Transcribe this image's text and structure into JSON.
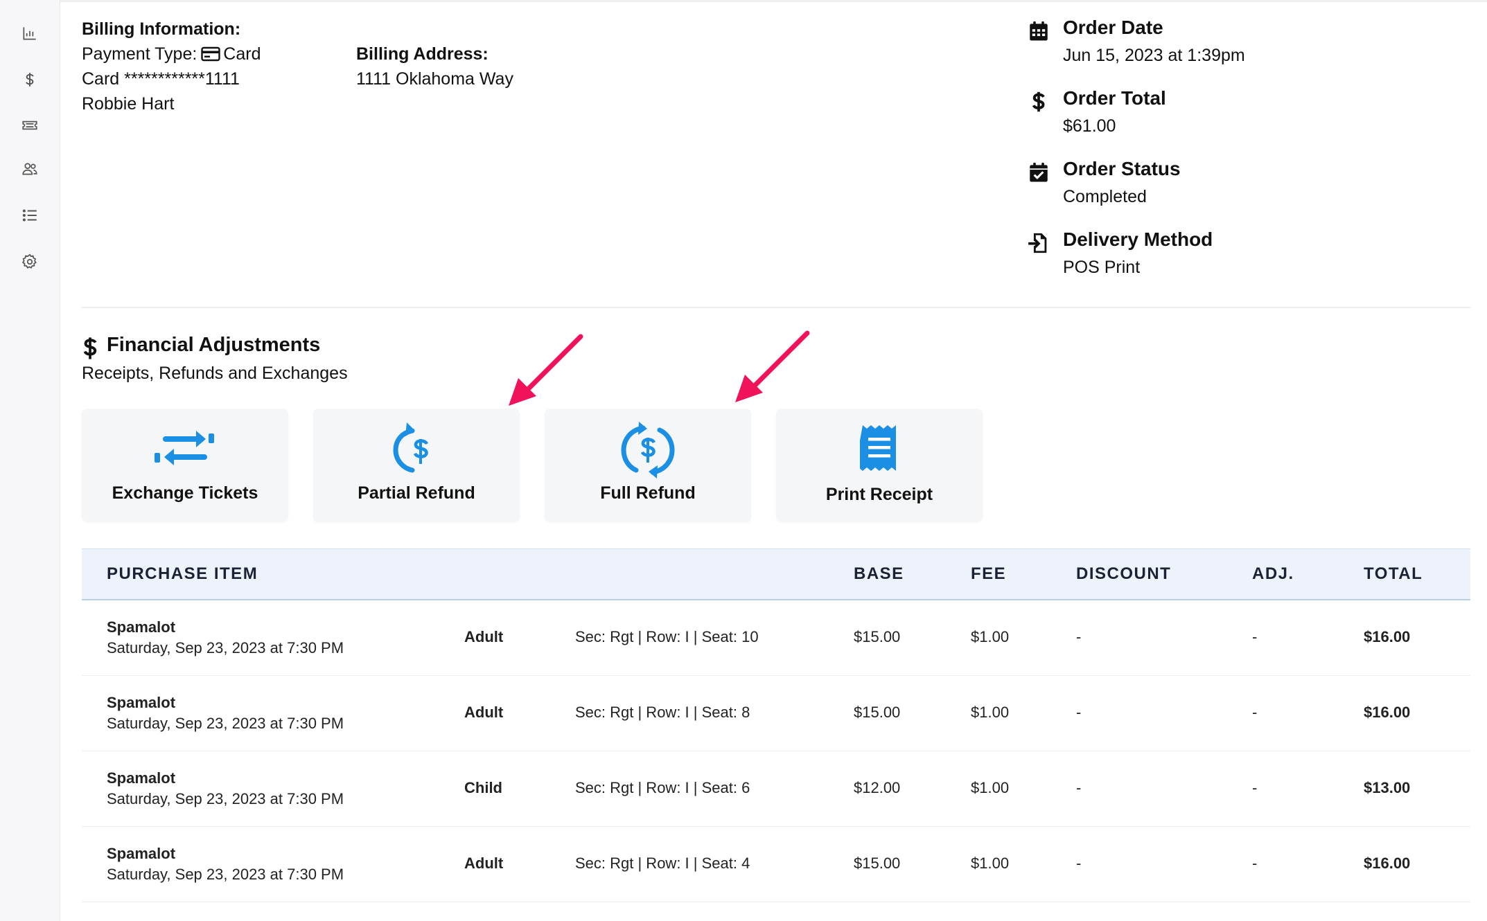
{
  "sidebar": {
    "items": [
      {
        "name": "chart-icon"
      },
      {
        "name": "dollar-icon"
      },
      {
        "name": "ticket-icon"
      },
      {
        "name": "users-icon"
      },
      {
        "name": "list-icon"
      },
      {
        "name": "gear-icon"
      }
    ]
  },
  "billing": {
    "heading": "Billing Information:",
    "payment_type_label": "Payment Type:",
    "payment_type_value": "Card",
    "card": "Card ************1111",
    "name": "Robbie Hart",
    "address_heading": "Billing Address:",
    "address": "1111 Oklahoma Way"
  },
  "order": {
    "date_label": "Order Date",
    "date_value": "Jun 15, 2023 at 1:39pm",
    "total_label": "Order Total",
    "total_value": "$61.00",
    "status_label": "Order Status",
    "status_value": "Completed",
    "delivery_label": "Delivery Method",
    "delivery_value": "POS Print"
  },
  "financial": {
    "title": "Financial Adjustments",
    "subtitle": "Receipts, Refunds and Exchanges",
    "actions": [
      {
        "label": "Exchange Tickets",
        "icon": "exchange-icon"
      },
      {
        "label": "Partial Refund",
        "icon": "partial-refund-icon"
      },
      {
        "label": "Full Refund",
        "icon": "full-refund-icon"
      },
      {
        "label": "Print Receipt",
        "icon": "receipt-icon"
      }
    ]
  },
  "colors": {
    "accent": "#1a8fe3",
    "annotation_arrow": "#f0135a",
    "header_bg": "#eef3fb"
  },
  "table": {
    "headers": {
      "item": "PURCHASE ITEM",
      "base": "BASE",
      "fee": "FEE",
      "discount": "DISCOUNT",
      "adj": "ADJ.",
      "total": "TOTAL"
    },
    "rows": [
      {
        "event": "Spamalot",
        "date": "Saturday, Sep 23, 2023 at 7:30 PM",
        "type": "Adult",
        "seat": "Sec: Rgt | Row: I | Seat: 10",
        "base": "$15.00",
        "fee": "$1.00",
        "discount": "-",
        "adj": "-",
        "total": "$16.00"
      },
      {
        "event": "Spamalot",
        "date": "Saturday, Sep 23, 2023 at 7:30 PM",
        "type": "Adult",
        "seat": "Sec: Rgt | Row: I | Seat: 8",
        "base": "$15.00",
        "fee": "$1.00",
        "discount": "-",
        "adj": "-",
        "total": "$16.00"
      },
      {
        "event": "Spamalot",
        "date": "Saturday, Sep 23, 2023 at 7:30 PM",
        "type": "Child",
        "seat": "Sec: Rgt | Row: I | Seat: 6",
        "base": "$12.00",
        "fee": "$1.00",
        "discount": "-",
        "adj": "-",
        "total": "$13.00"
      },
      {
        "event": "Spamalot",
        "date": "Saturday, Sep 23, 2023 at 7:30 PM",
        "type": "Adult",
        "seat": "Sec: Rgt | Row: I | Seat: 4",
        "base": "$15.00",
        "fee": "$1.00",
        "discount": "-",
        "adj": "-",
        "total": "$16.00"
      }
    ]
  }
}
